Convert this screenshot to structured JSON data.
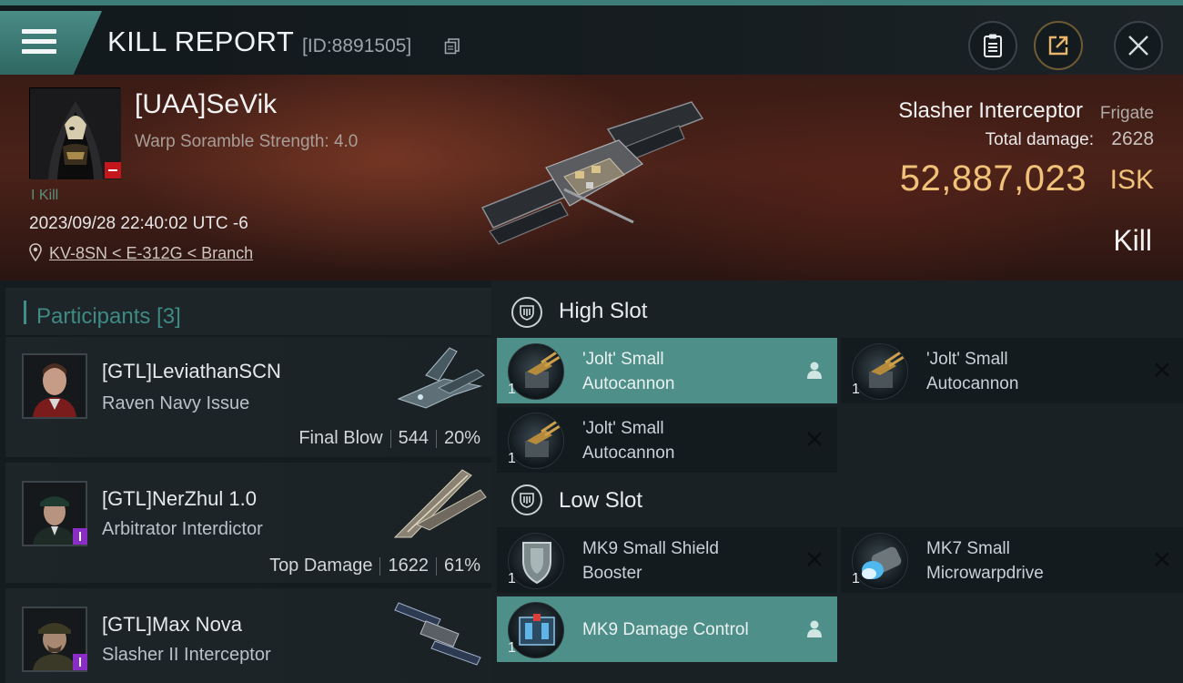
{
  "header": {
    "title": "KILL REPORT",
    "report_id": "[ID:8891505]"
  },
  "victim": {
    "name": "[UAA]SeVik",
    "subtitle": "Warp Soramble Strength: 4.0",
    "kills_tag": "I Kill",
    "datetime": "2023/09/28 22:40:02 UTC -6",
    "location": "KV-8SN < E-312G < Branch",
    "ship_name": "Slasher Interceptor",
    "ship_class": "Frigate",
    "damage_label": "Total damage:",
    "damage_value": "2628",
    "isk_value": "52,887,023",
    "isk_unit": "ISK",
    "outcome": "Kill"
  },
  "participants": {
    "label": "Participants [3]",
    "items": [
      {
        "name": "[GTL]LeviathanSCN",
        "ship": "Raven Navy Issue",
        "role": "Final Blow",
        "damage": "544",
        "percent": "20%"
      },
      {
        "name": "[GTL]NerZhul 1.0",
        "ship": "Arbitrator Interdictor",
        "role": "Top Damage",
        "damage": "1622",
        "percent": "61%"
      },
      {
        "name": "[GTL]Max Nova",
        "ship": "Slasher II Interceptor",
        "role": "",
        "damage": "",
        "percent": ""
      }
    ]
  },
  "fittings": {
    "high_slot": {
      "label": "High Slot",
      "modules": [
        {
          "qty": "1",
          "line1": "'Jolt' Small",
          "line2": "Autocannon",
          "status": "dropped"
        },
        {
          "qty": "1",
          "line1": "'Jolt' Small",
          "line2": "Autocannon",
          "status": "destroyed"
        },
        {
          "qty": "1",
          "line1": "'Jolt' Small",
          "line2": "Autocannon",
          "status": "destroyed"
        }
      ]
    },
    "low_slot": {
      "label": "Low Slot",
      "modules": [
        {
          "qty": "1",
          "line1": "MK9 Small Shield",
          "line2": "Booster",
          "status": "destroyed"
        },
        {
          "qty": "1",
          "line1": "MK7 Small",
          "line2": "Microwarpdrive",
          "status": "destroyed"
        },
        {
          "qty": "1",
          "line1": "MK9 Damage Control",
          "line2": "",
          "status": "dropped"
        }
      ]
    }
  },
  "colors": {
    "accent_teal": "#4f8f89",
    "isk_gold": "#f0c178",
    "kill_badge_red": "#c4161c",
    "participant_badge_purple": "#8a2dc7"
  },
  "icons": {
    "menu": "hamburger-icon",
    "copy": "copy-icon",
    "clipboard": "clipboard-icon",
    "share": "share-icon",
    "close": "close-icon",
    "location": "location-pin-icon",
    "slot": "shield-slot-icon",
    "dropped": "person-icon",
    "destroyed": "x-icon"
  }
}
